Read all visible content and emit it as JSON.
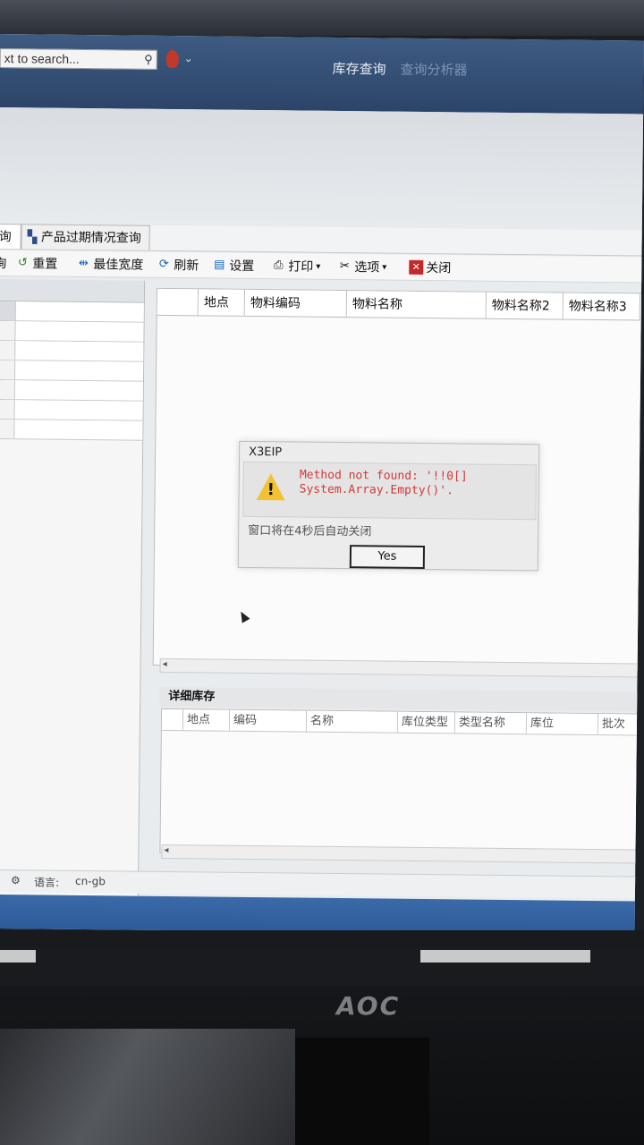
{
  "titlebar": {
    "search_placeholder": "xt to search...",
    "tabs": [
      "库存查询",
      "查询分析器"
    ]
  },
  "doc_tabs": [
    "询",
    "产品过期情况查询"
  ],
  "toolbar": [
    "询",
    "重置",
    "最佳宽度",
    "刷新",
    "设置",
    "打印",
    "选项",
    "关闭"
  ],
  "main_grid": {
    "columns": [
      "地点",
      "物料编码",
      "物料名称",
      "物料名称2",
      "物料名称3"
    ]
  },
  "dialog": {
    "title": "X3EIP",
    "message_line1": "Method not found: '!!0[]",
    "message_line2": "System.Array.Empty()'.",
    "note": "窗口将在4秒后自动关闭",
    "button": "Yes"
  },
  "detail": {
    "title": "详细库存",
    "columns": [
      "地点",
      "编码",
      "名称",
      "库位类型",
      "类型名称",
      "库位",
      "批次"
    ]
  },
  "statusbar": {
    "left": "员",
    "lang_label": "语言:",
    "lang_value": "cn-gb"
  },
  "monitor": {
    "brand": "AOC"
  }
}
